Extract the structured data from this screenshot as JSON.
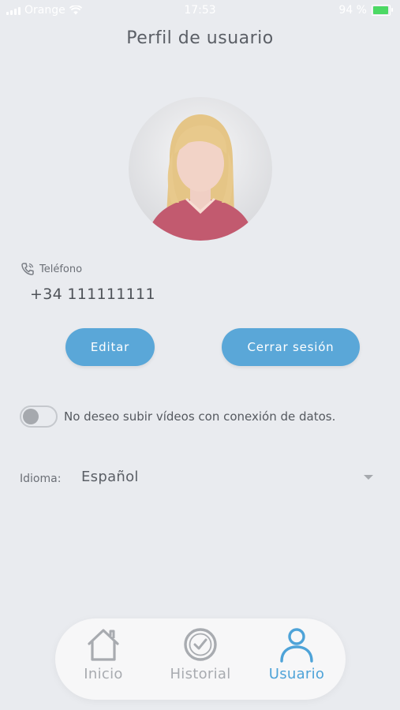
{
  "status_bar": {
    "carrier": "Orange",
    "time": "17:53",
    "battery": "94 %"
  },
  "page": {
    "title": "Perfil de usuario"
  },
  "profile": {
    "phone_label": "Teléfono",
    "phone_value": "+34 111111111"
  },
  "actions": {
    "edit_label": "Editar",
    "logout_label": "Cerrar sesión"
  },
  "settings": {
    "no_mobile_data_upload_label": "No deseo subir vídeos con conexión de datos.",
    "no_mobile_data_upload_enabled": false,
    "language_label": "Idioma:",
    "language_value": "Español"
  },
  "tab_bar": {
    "tabs": [
      {
        "label": "Inicio",
        "icon": "home-icon",
        "active": false
      },
      {
        "label": "Historial",
        "icon": "clock-icon",
        "active": false
      },
      {
        "label": "Usuario",
        "icon": "user-icon",
        "active": true
      }
    ]
  },
  "colors": {
    "accent": "#5aa7d8",
    "active_tab": "#4ea3d8",
    "inactive_tab": "#a8abb0",
    "background": "#e9ebef",
    "battery_charging": "#4cd964"
  }
}
